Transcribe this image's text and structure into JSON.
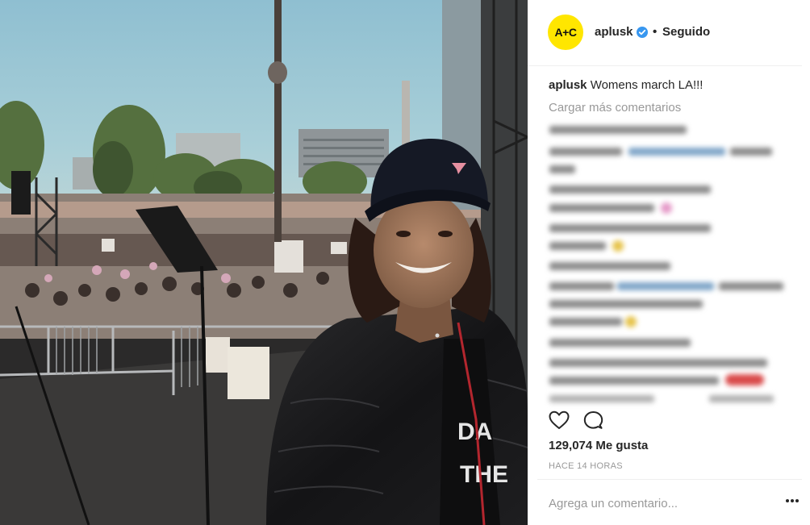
{
  "post": {
    "username": "aplusk",
    "avatar_text": "A+C",
    "separator": "•",
    "follow_status": "Seguido",
    "caption_user": "aplusk",
    "caption_text": "Womens march LA!!!",
    "load_more_label": "Cargar más comentarios",
    "likes_text": "129,074 Me gusta",
    "timestamp": "HACE 14 HORAS",
    "comment_placeholder": "Agrega un comentario..."
  },
  "colors": {
    "avatar_bg": "#ffe600",
    "verified_blue": "#3897f0",
    "secondary_text": "#999999",
    "primary_text": "#262626"
  },
  "icons": {
    "verified": "verified-badge-icon",
    "like": "heart-outline-icon",
    "comment": "comment-bubble-icon",
    "options": "more-options-icon"
  }
}
